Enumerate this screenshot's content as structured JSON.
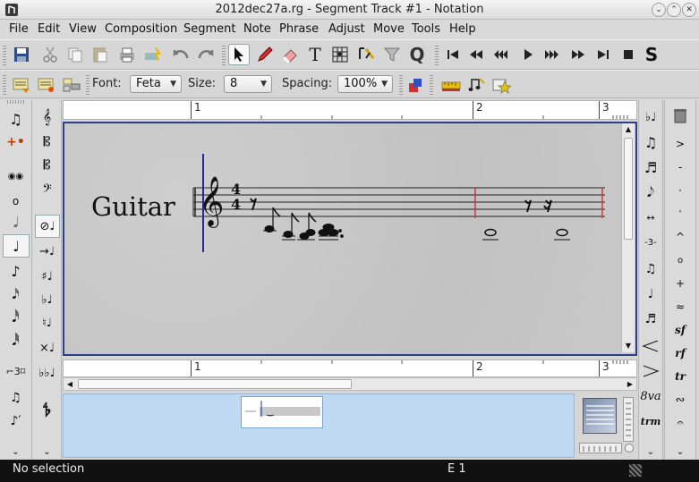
{
  "window": {
    "title": "2012dec27a.rg - Segment Track #1 - Notation"
  },
  "menubar": {
    "items": [
      "File",
      "Edit",
      "View",
      "Composition",
      "Segment",
      "Note",
      "Phrase",
      "Adjust",
      "Move",
      "Tools",
      "Help"
    ]
  },
  "toolbar_text": {
    "font_label": "Font:",
    "font_value": "Feta",
    "size_label": "Size:",
    "size_value": "8",
    "spacing_label": "Spacing:",
    "spacing_value": "100%"
  },
  "ruler": {
    "bar_labels": [
      "1",
      "2",
      "3"
    ]
  },
  "staff": {
    "instrument": "Guitar",
    "time_signature_top": "4",
    "time_signature_bottom": "4"
  },
  "right_palette": {
    "dynamics": [
      "sf",
      "rf",
      "tr",
      "8va",
      "trm"
    ]
  },
  "status": {
    "selection": "No selection",
    "position": "E 1"
  },
  "colors": {
    "notation_border": "#2b3f86",
    "cursor": "#1a2ca0",
    "barline_marker": "#c83a3a",
    "panner_bg": "#bfd9f2",
    "status_bg": "#111111"
  }
}
